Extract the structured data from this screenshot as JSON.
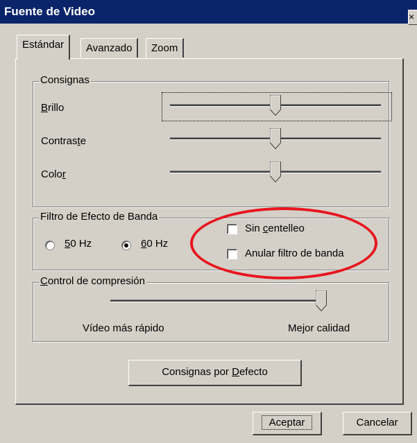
{
  "window": {
    "title": "Fuente de Video",
    "close_glyph": "×"
  },
  "tabs": [
    {
      "label": "Estándar",
      "active": true
    },
    {
      "label": "Avanzado",
      "active": false
    },
    {
      "label": "Zoom",
      "active": false
    }
  ],
  "consignas": {
    "legend": "Consignas",
    "sliders": [
      {
        "label_pre": "",
        "label_u": "B",
        "label_post": "rillo",
        "value": 0.5
      },
      {
        "label_pre": "Contras",
        "label_u": "t",
        "label_post": "e",
        "value": 0.5
      },
      {
        "label_pre": "Colo",
        "label_u": "r",
        "label_post": "",
        "value": 0.5
      }
    ]
  },
  "banda": {
    "legend": "Filtro de Efecto de Banda",
    "radio_50": {
      "u": "5",
      "rest": "0 Hz",
      "checked": false
    },
    "radio_60": {
      "u": "6",
      "rest": "0 Hz",
      "checked": true
    },
    "sin_centelleo": {
      "pre": "Sin ",
      "u": "c",
      "post": "entelleo",
      "checked": false
    },
    "anular": {
      "label": "Anular filtro de banda",
      "checked": false
    }
  },
  "compresion": {
    "legend_u": "C",
    "legend_rest": "ontrol de compresión",
    "value": 1.0,
    "left_label": "Vídeo más rápido",
    "right_label": "Mejor calidad"
  },
  "buttons": {
    "defecto_pre": "Consignas por ",
    "defecto_u": "D",
    "defecto_post": "efecto",
    "aceptar": "Aceptar",
    "cancelar": "Cancelar"
  },
  "annotation_color": "#e8141e"
}
